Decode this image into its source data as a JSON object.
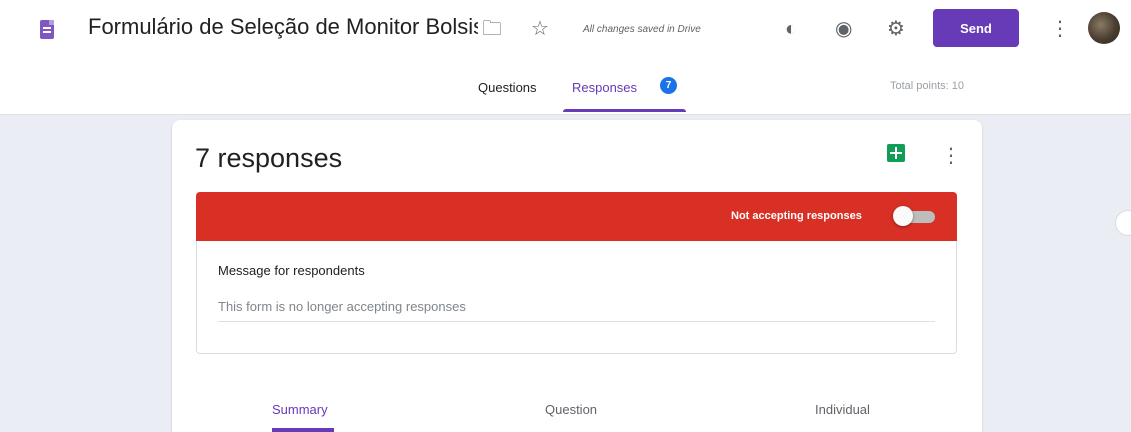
{
  "header": {
    "title": "Formulário de Seleção de Monitor Bolsista",
    "save_status": "All changes saved in Drive",
    "send_label": "Send"
  },
  "tabs": {
    "questions": "Questions",
    "responses": "Responses",
    "responses_badge": "7",
    "total_points": "Total points: 10"
  },
  "card": {
    "count": "7 responses",
    "banner_text": "Not accepting responses",
    "accepting_toggle": "off",
    "message_label": "Message for respondents",
    "message_value": "This form is no longer accepting responses"
  },
  "subtabs": {
    "summary": "Summary",
    "question": "Question",
    "individual": "Individual"
  },
  "colors": {
    "accent": "#673ab7",
    "banner": "#d93025",
    "sheets": "#0f9d58",
    "badge": "#1a73e8"
  }
}
